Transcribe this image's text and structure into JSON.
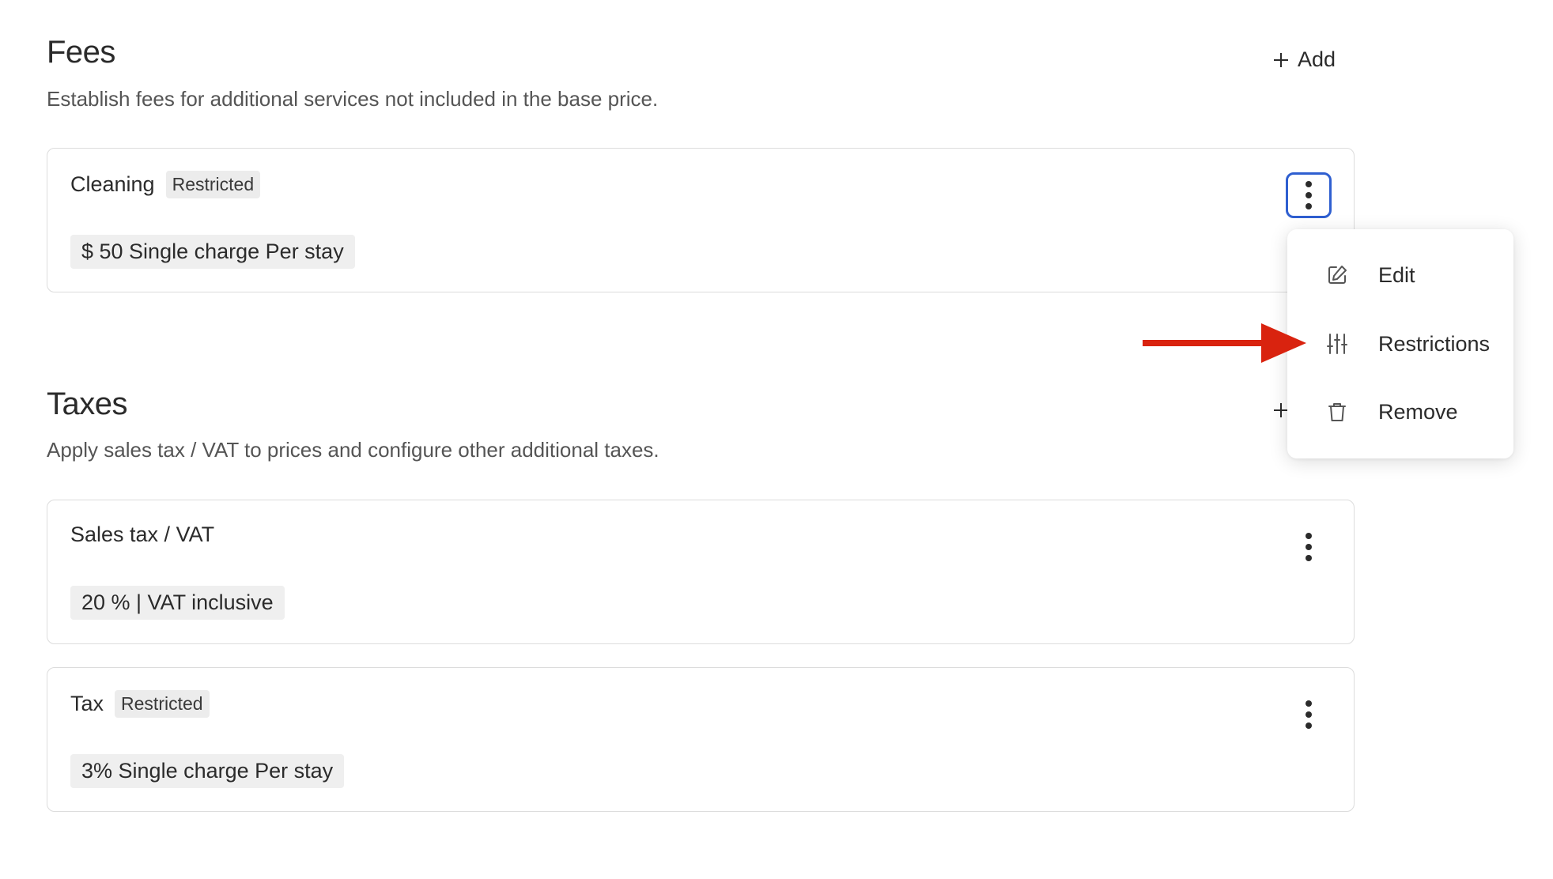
{
  "fees": {
    "title": "Fees",
    "description": "Establish fees for additional services not included in the base price.",
    "add_label": "Add",
    "items": [
      {
        "name": "Cleaning",
        "badge": "Restricted",
        "detail": "$ 50 Single charge Per stay"
      }
    ]
  },
  "taxes": {
    "title": "Taxes",
    "description": "Apply sales tax / VAT to prices and configure other additional taxes.",
    "add_label": "",
    "items": [
      {
        "name": "Sales tax / VAT",
        "detail": "20 % | VAT inclusive"
      },
      {
        "name": "Tax",
        "badge": "Restricted",
        "detail": "3% Single charge Per stay"
      }
    ]
  },
  "context_menu": {
    "items": [
      {
        "label": "Edit",
        "icon": "edit-icon"
      },
      {
        "label": "Restrictions",
        "icon": "sliders-icon"
      },
      {
        "label": "Remove",
        "icon": "trash-icon"
      }
    ]
  },
  "colors": {
    "focus_ring": "#2f5fd0",
    "annotation_arrow": "#d9230f",
    "badge_bg": "#ececec"
  }
}
